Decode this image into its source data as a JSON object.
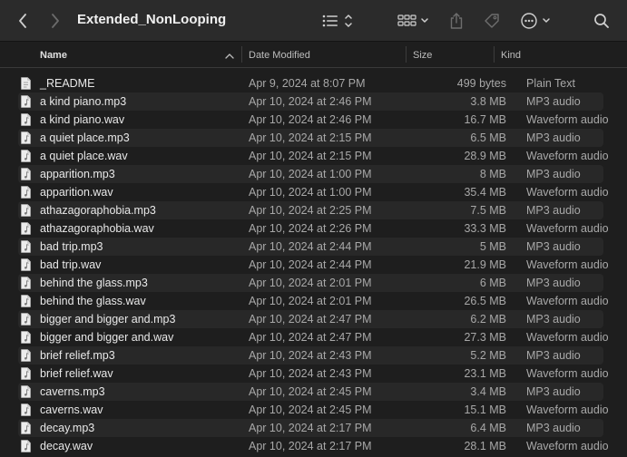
{
  "window": {
    "title": "Extended_NonLooping"
  },
  "columns": {
    "name": "Name",
    "date": "Date Modified",
    "size": "Size",
    "kind": "Kind"
  },
  "files": [
    {
      "name": "_README",
      "date": "Apr 9, 2024 at 8:07 PM",
      "size": "499 bytes",
      "kind": "Plain Text"
    },
    {
      "name": "a kind piano.mp3",
      "date": "Apr 10, 2024 at 2:46 PM",
      "size": "3.8 MB",
      "kind": "MP3 audio"
    },
    {
      "name": "a kind piano.wav",
      "date": "Apr 10, 2024 at 2:46 PM",
      "size": "16.7 MB",
      "kind": "Waveform audio"
    },
    {
      "name": "a quiet place.mp3",
      "date": "Apr 10, 2024 at 2:15 PM",
      "size": "6.5 MB",
      "kind": "MP3 audio"
    },
    {
      "name": "a quiet place.wav",
      "date": "Apr 10, 2024 at 2:15 PM",
      "size": "28.9 MB",
      "kind": "Waveform audio"
    },
    {
      "name": "apparition.mp3",
      "date": "Apr 10, 2024 at 1:00 PM",
      "size": "8 MB",
      "kind": "MP3 audio"
    },
    {
      "name": "apparition.wav",
      "date": "Apr 10, 2024 at 1:00 PM",
      "size": "35.4 MB",
      "kind": "Waveform audio"
    },
    {
      "name": "athazagoraphobia.mp3",
      "date": "Apr 10, 2024 at 2:25 PM",
      "size": "7.5 MB",
      "kind": "MP3 audio"
    },
    {
      "name": "athazagoraphobia.wav",
      "date": "Apr 10, 2024 at 2:26 PM",
      "size": "33.3 MB",
      "kind": "Waveform audio"
    },
    {
      "name": "bad trip.mp3",
      "date": "Apr 10, 2024 at 2:44 PM",
      "size": "5 MB",
      "kind": "MP3 audio"
    },
    {
      "name": "bad trip.wav",
      "date": "Apr 10, 2024 at 2:44 PM",
      "size": "21.9 MB",
      "kind": "Waveform audio"
    },
    {
      "name": "behind the glass.mp3",
      "date": "Apr 10, 2024 at 2:01 PM",
      "size": "6 MB",
      "kind": "MP3 audio"
    },
    {
      "name": "behind the glass.wav",
      "date": "Apr 10, 2024 at 2:01 PM",
      "size": "26.5 MB",
      "kind": "Waveform audio"
    },
    {
      "name": "bigger and bigger and.mp3",
      "date": "Apr 10, 2024 at 2:47 PM",
      "size": "6.2 MB",
      "kind": "MP3 audio"
    },
    {
      "name": "bigger and bigger and.wav",
      "date": "Apr 10, 2024 at 2:47 PM",
      "size": "27.3 MB",
      "kind": "Waveform audio"
    },
    {
      "name": "brief relief.mp3",
      "date": "Apr 10, 2024 at 2:43 PM",
      "size": "5.2 MB",
      "kind": "MP3 audio"
    },
    {
      "name": "brief relief.wav",
      "date": "Apr 10, 2024 at 2:43 PM",
      "size": "23.1 MB",
      "kind": "Waveform audio"
    },
    {
      "name": "caverns.mp3",
      "date": "Apr 10, 2024 at 2:45 PM",
      "size": "3.4 MB",
      "kind": "MP3 audio"
    },
    {
      "name": "caverns.wav",
      "date": "Apr 10, 2024 at 2:45 PM",
      "size": "15.1 MB",
      "kind": "Waveform audio"
    },
    {
      "name": "decay.mp3",
      "date": "Apr 10, 2024 at 2:17 PM",
      "size": "6.4 MB",
      "kind": "MP3 audio"
    },
    {
      "name": "decay.wav",
      "date": "Apr 10, 2024 at 2:17 PM",
      "size": "28.1 MB",
      "kind": "Waveform audio"
    }
  ]
}
